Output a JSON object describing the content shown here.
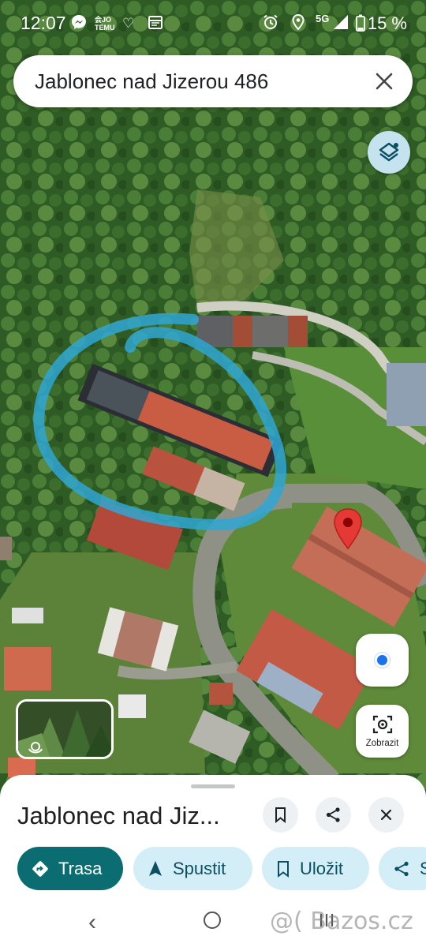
{
  "status_bar": {
    "time": "12:07",
    "network": "5G",
    "battery": "15 %",
    "icons": [
      "messenger-icon",
      "temu-icon",
      "heart-icon",
      "calendar-icon",
      "alarm-icon",
      "location-icon",
      "signal-icon",
      "battery-icon"
    ]
  },
  "search": {
    "query": "Jablonec nad Jizerou 486"
  },
  "map": {
    "layers_icon": "layers-icon",
    "my_location_icon": "my-location-icon",
    "lens_label": "Zobrazit",
    "pin_color": "#e53935"
  },
  "place": {
    "title": "Jablonec nad Jiz...",
    "save_icon": "bookmark-icon",
    "share_icon": "share-icon",
    "close_icon": "close-icon"
  },
  "actions": [
    {
      "label": "Trasa",
      "icon": "directions-icon"
    },
    {
      "label": "Spustit",
      "icon": "navigation-arrow-icon"
    },
    {
      "label": "Uložit",
      "icon": "bookmark-icon"
    },
    {
      "label": "S",
      "icon": "share-icon"
    }
  ],
  "watermark": "@( Bazos.cz",
  "colors": {
    "primary": "#0b6d71",
    "secondary_chip": "#d4eef8"
  }
}
